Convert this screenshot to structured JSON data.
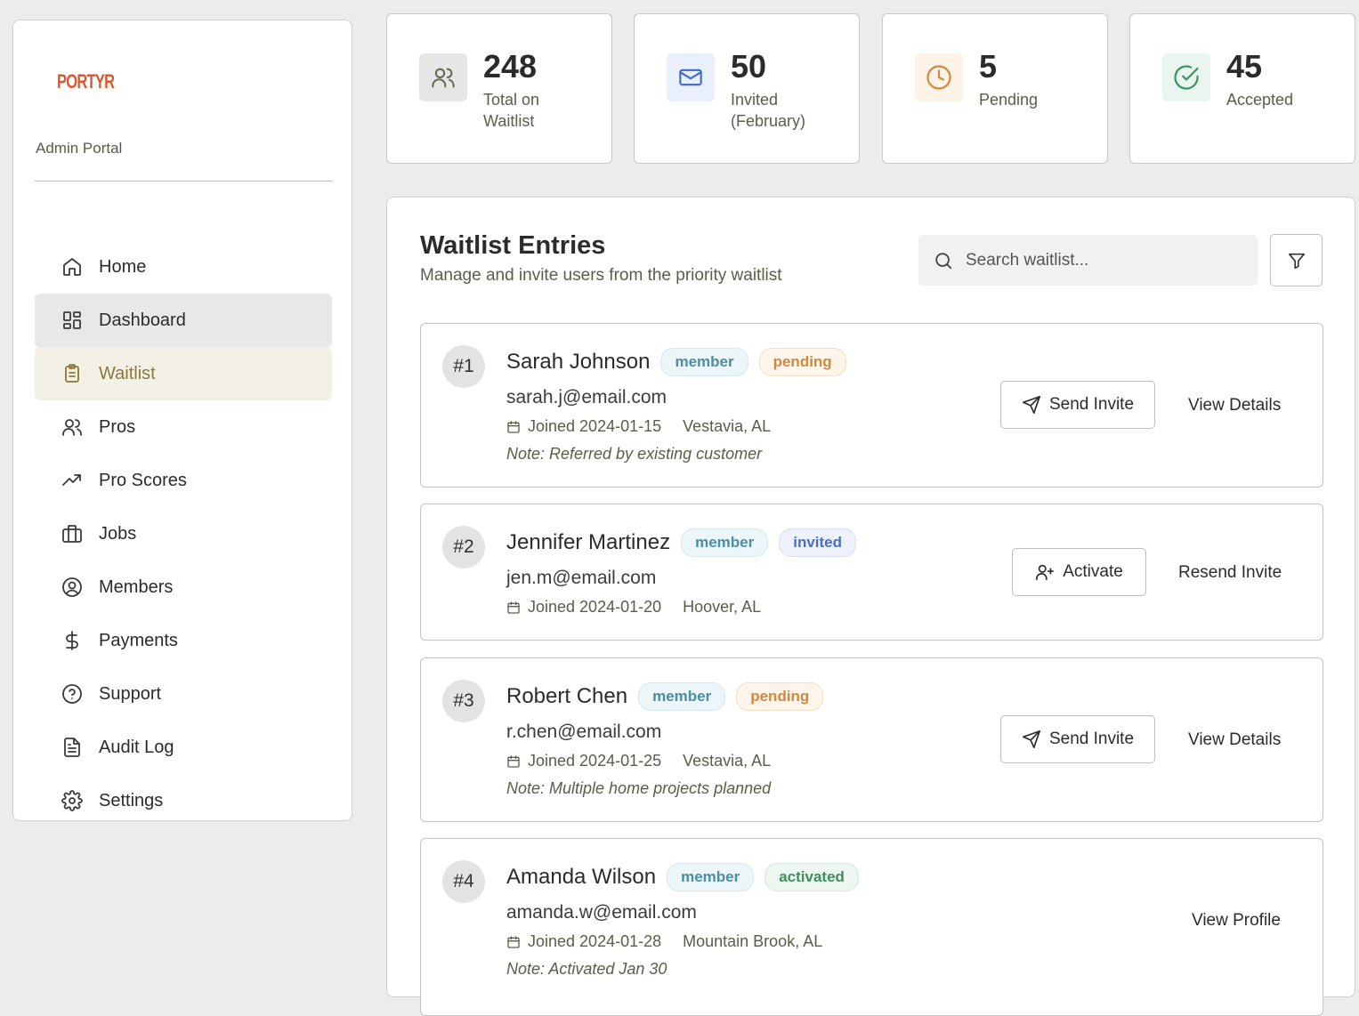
{
  "sidebar": {
    "logo": "PORTYR",
    "portal_label": "Admin Portal",
    "items": [
      {
        "label": "Home",
        "icon": "home-icon"
      },
      {
        "label": "Dashboard",
        "icon": "dashboard-icon"
      },
      {
        "label": "Waitlist",
        "icon": "clipboard-icon"
      },
      {
        "label": "Pros",
        "icon": "users-icon"
      },
      {
        "label": "Pro Scores",
        "icon": "trending-up-icon"
      },
      {
        "label": "Jobs",
        "icon": "briefcase-icon"
      },
      {
        "label": "Members",
        "icon": "user-circle-icon"
      },
      {
        "label": "Payments",
        "icon": "dollar-icon"
      },
      {
        "label": "Support",
        "icon": "help-circle-icon"
      },
      {
        "label": "Audit Log",
        "icon": "file-text-icon"
      },
      {
        "label": "Settings",
        "icon": "gear-icon"
      }
    ]
  },
  "stats": [
    {
      "value": "248",
      "label": "Total on Waitlist",
      "icon": "users-icon",
      "icon_bg": "#e6e6e6",
      "icon_color": "#6b6b55"
    },
    {
      "value": "50",
      "label": "Invited (February)",
      "icon": "mail-icon",
      "icon_bg": "#eaf0fb",
      "icon_color": "#3f68c9"
    },
    {
      "value": "5",
      "label": "Pending",
      "icon": "clock-icon",
      "icon_bg": "#fdf3e7",
      "icon_color": "#d4893c"
    },
    {
      "value": "45",
      "label": "Accepted",
      "icon": "check-circle-icon",
      "icon_bg": "#e9f5ee",
      "icon_color": "#3f9460"
    }
  ],
  "panel": {
    "title": "Waitlist Entries",
    "subtitle": "Manage and invite users from the priority waitlist",
    "search_placeholder": "Search waitlist..."
  },
  "entries": [
    {
      "rank": "#1",
      "name": "Sarah Johnson",
      "type": "member",
      "status": "pending",
      "email": "sarah.j@email.com",
      "joined": "Joined 2024-01-15",
      "location": "Vestavia, AL",
      "note": "Note: Referred by existing customer",
      "primary_action": "Send Invite",
      "secondary_action": "View Details"
    },
    {
      "rank": "#2",
      "name": "Jennifer Martinez",
      "type": "member",
      "status": "invited",
      "email": "jen.m@email.com",
      "joined": "Joined 2024-01-20",
      "location": "Hoover, AL",
      "note": "",
      "primary_action": "Activate",
      "secondary_action": "Resend Invite"
    },
    {
      "rank": "#3",
      "name": "Robert Chen",
      "type": "member",
      "status": "pending",
      "email": "r.chen@email.com",
      "joined": "Joined 2024-01-25",
      "location": "Vestavia, AL",
      "note": "Note: Multiple home projects planned",
      "primary_action": "Send Invite",
      "secondary_action": "View Details"
    },
    {
      "rank": "#4",
      "name": "Amanda Wilson",
      "type": "member",
      "status": "activated",
      "email": "amanda.w@email.com",
      "joined": "Joined 2024-01-28",
      "location": "Mountain Brook, AL",
      "note": "Note: Activated Jan 30",
      "primary_action": "",
      "secondary_action": "View Profile"
    }
  ]
}
